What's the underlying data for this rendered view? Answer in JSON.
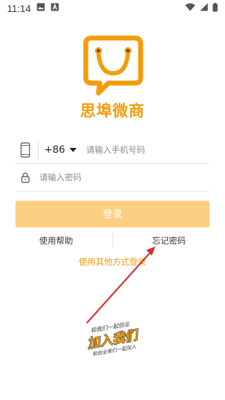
{
  "status_bar": {
    "time": "11:14",
    "left_icons": [
      "image-icon",
      "text-a-icon"
    ],
    "right_icons": [
      "wifi-icon",
      "signal-icon",
      "battery-icon"
    ]
  },
  "brand": {
    "name": "思埠微商",
    "color": "#f39c0a"
  },
  "login_form": {
    "country_code": "+86",
    "phone_placeholder": "请输入手机号码",
    "password_placeholder": "请输入密码",
    "login_button": "登录",
    "help_link": "使用帮助",
    "forgot_link": "忘记密码",
    "other_login": "使用其他方式登录"
  },
  "promo": {
    "main_text": "加入我们",
    "top_small_text": "和我们一起创业",
    "bottom_small_text": "和创业者们一起加入"
  },
  "colors": {
    "accent": "#f39c0a",
    "button_bg": "#fcd083",
    "arrow": "#d32f2f"
  }
}
